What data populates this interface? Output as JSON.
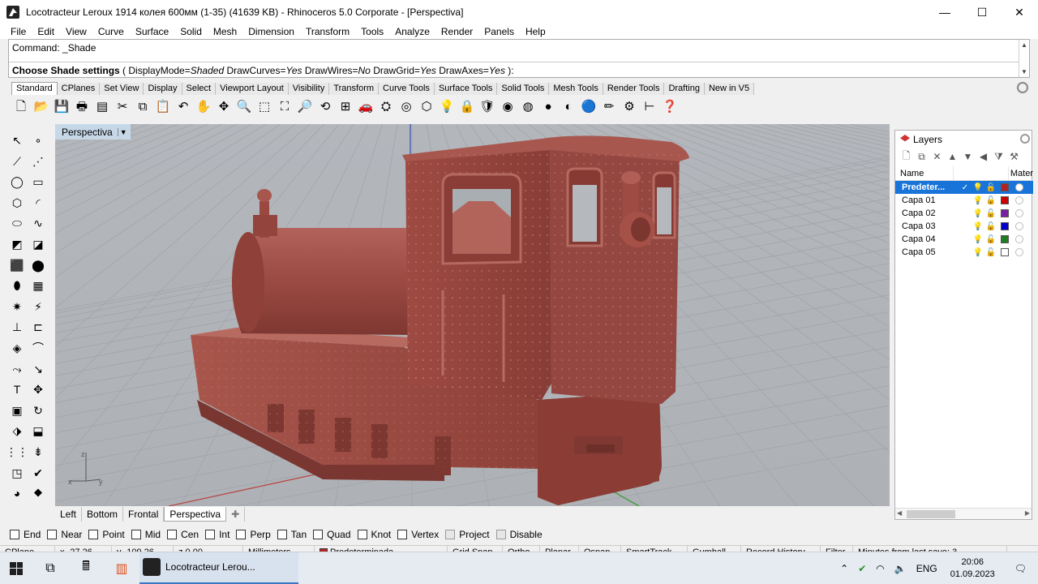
{
  "window": {
    "title": "Locotracteur Leroux 1914 колея 600мм (1-35) (41639 KB) - Rhinoceros  5.0 Corporate - [Perspectiva]",
    "minimize": "—",
    "maximize": "☐",
    "close": "✕"
  },
  "menu": [
    "File",
    "Edit",
    "View",
    "Curve",
    "Surface",
    "Solid",
    "Mesh",
    "Dimension",
    "Transform",
    "Tools",
    "Analyze",
    "Render",
    "Panels",
    "Help"
  ],
  "command": {
    "history": "Command: _Shade",
    "prompt_bold": "Choose Shade settings",
    "prompt_rest_1": " ( DisplayMode=",
    "display_mode": "Shaded",
    "prompt_rest_2": "  DrawCurves=",
    "draw_curves": "Yes",
    "prompt_rest_3": "  DrawWires=",
    "draw_wires": "No",
    "prompt_rest_4": "  DrawGrid=",
    "draw_grid": "Yes",
    "prompt_rest_5": "  DrawAxes=",
    "draw_axes": "Yes",
    "prompt_end": " ):"
  },
  "toolbar_tabs": [
    "Standard",
    "CPlanes",
    "Set View",
    "Display",
    "Select",
    "Viewport Layout",
    "Visibility",
    "Transform",
    "Curve Tools",
    "Surface Tools",
    "Solid Tools",
    "Mesh Tools",
    "Render Tools",
    "Drafting",
    "New in V5"
  ],
  "toolbar_icons": [
    {
      "name": "new-file-icon",
      "glyph": "🗋"
    },
    {
      "name": "open-file-icon",
      "glyph": "📂"
    },
    {
      "name": "save-icon",
      "glyph": "💾"
    },
    {
      "name": "print-icon",
      "glyph": "🖶"
    },
    {
      "name": "import-icon",
      "glyph": "▤"
    },
    {
      "name": "cut-icon",
      "glyph": "✂"
    },
    {
      "name": "copy-icon",
      "glyph": "⧉"
    },
    {
      "name": "paste-icon",
      "glyph": "📋"
    },
    {
      "name": "undo-icon",
      "glyph": "↶"
    },
    {
      "name": "pan-icon",
      "glyph": "✋"
    },
    {
      "name": "move-view-icon",
      "glyph": "✥"
    },
    {
      "name": "zoom-icon",
      "glyph": "🔍"
    },
    {
      "name": "zoom-window-icon",
      "glyph": "⬚"
    },
    {
      "name": "zoom-extents-icon",
      "glyph": "⛶"
    },
    {
      "name": "zoom-selected-icon",
      "glyph": "🔎"
    },
    {
      "name": "rotate-view-icon",
      "glyph": "⟲"
    },
    {
      "name": "four-viewports-icon",
      "glyph": "⊞"
    },
    {
      "name": "car-icon",
      "glyph": "🚗"
    },
    {
      "name": "camera-icon",
      "glyph": "⛭"
    },
    {
      "name": "target-icon",
      "glyph": "◎"
    },
    {
      "name": "cplane-icon",
      "glyph": "⬡"
    },
    {
      "name": "light-bulb-icon",
      "glyph": "💡"
    },
    {
      "name": "lock-icon",
      "glyph": "🔒"
    },
    {
      "name": "layer-shield-icon",
      "glyph": "🛡"
    },
    {
      "name": "color-wheel-icon",
      "glyph": "◉"
    },
    {
      "name": "sphere-wire-icon",
      "glyph": "◍"
    },
    {
      "name": "sphere-shaded-icon",
      "glyph": "●"
    },
    {
      "name": "sphere-render-icon",
      "glyph": "◐"
    },
    {
      "name": "sphere-blue-icon",
      "glyph": "🔵"
    },
    {
      "name": "pencil-icon",
      "glyph": "✏"
    },
    {
      "name": "gear-gold-icon",
      "glyph": "⚙"
    },
    {
      "name": "dimension-icon",
      "glyph": "⊢"
    },
    {
      "name": "help-icon",
      "glyph": "❓"
    }
  ],
  "left_palette": [
    {
      "name": "select-arrow-icon",
      "glyph": "↖"
    },
    {
      "name": "point-icon",
      "glyph": "∘"
    },
    {
      "name": "polyline-icon",
      "glyph": "⟋"
    },
    {
      "name": "curve-points-icon",
      "glyph": "⋰"
    },
    {
      "name": "circle-icon",
      "glyph": "◯"
    },
    {
      "name": "rectangle-icon",
      "glyph": "▭"
    },
    {
      "name": "polygon-icon",
      "glyph": "⬡"
    },
    {
      "name": "arc-icon",
      "glyph": "◜"
    },
    {
      "name": "ellipse-icon",
      "glyph": "⬭"
    },
    {
      "name": "freeform-icon",
      "glyph": "∿"
    },
    {
      "name": "surface-corner-icon",
      "glyph": "◩"
    },
    {
      "name": "surface-patch-icon",
      "glyph": "◪"
    },
    {
      "name": "box-icon",
      "glyph": "⬛"
    },
    {
      "name": "solid-union-icon",
      "glyph": "⬤"
    },
    {
      "name": "cylinder-icon",
      "glyph": "⬮"
    },
    {
      "name": "mesh-icon",
      "glyph": "▦"
    },
    {
      "name": "explode-icon",
      "glyph": "✷"
    },
    {
      "name": "trim-icon",
      "glyph": "⚡"
    },
    {
      "name": "split-icon",
      "glyph": "⊥"
    },
    {
      "name": "join-icon",
      "glyph": "⊏"
    },
    {
      "name": "boolean-icon",
      "glyph": "◈"
    },
    {
      "name": "fillet-icon",
      "glyph": "⌒"
    },
    {
      "name": "offset-icon",
      "glyph": "⤳"
    },
    {
      "name": "extend-icon",
      "glyph": "↘"
    },
    {
      "name": "text-icon",
      "glyph": "T"
    },
    {
      "name": "move-icon",
      "glyph": "✥"
    },
    {
      "name": "scale-icon",
      "glyph": "▣"
    },
    {
      "name": "rotate-icon",
      "glyph": "↻"
    },
    {
      "name": "extrude-icon",
      "glyph": "⬗"
    },
    {
      "name": "array-icon",
      "glyph": "⬓"
    },
    {
      "name": "grid-array-icon",
      "glyph": "⋮⋮"
    },
    {
      "name": "align-icon",
      "glyph": "⇟"
    },
    {
      "name": "analyze-icon",
      "glyph": "◳"
    },
    {
      "name": "check-icon",
      "glyph": "✔"
    },
    {
      "name": "sphere-tool-icon",
      "glyph": "◕"
    },
    {
      "name": "render-tool-icon",
      "glyph": "⯁"
    }
  ],
  "viewport": {
    "title": "Perspectiva",
    "dropdown": "▼"
  },
  "viewport_tabs": [
    "Left",
    "Bottom",
    "Frontal",
    "Perspectiva"
  ],
  "viewport_tab_add": "✚",
  "layers": {
    "title": "Layers",
    "columns": {
      "name": "Name",
      "material": "Mater"
    },
    "rows": [
      {
        "name": "Predeter...",
        "current": "✓",
        "color": "#b22222",
        "selected": true
      },
      {
        "name": "Capa 01",
        "current": "",
        "color": "#cc0000",
        "selected": false
      },
      {
        "name": "Capa 02",
        "current": "",
        "color": "#7b1fa2",
        "selected": false
      },
      {
        "name": "Capa 03",
        "current": "",
        "color": "#0000cc",
        "selected": false
      },
      {
        "name": "Capa 04",
        "current": "",
        "color": "#1e7d1e",
        "selected": false
      },
      {
        "name": "Capa 05",
        "current": "",
        "color": "#ffffff",
        "selected": false
      }
    ]
  },
  "osnaps": [
    {
      "label": "End",
      "enabled": true
    },
    {
      "label": "Near",
      "enabled": true
    },
    {
      "label": "Point",
      "enabled": true
    },
    {
      "label": "Mid",
      "enabled": true
    },
    {
      "label": "Cen",
      "enabled": true
    },
    {
      "label": "Int",
      "enabled": true
    },
    {
      "label": "Perp",
      "enabled": true
    },
    {
      "label": "Tan",
      "enabled": true
    },
    {
      "label": "Quad",
      "enabled": true
    },
    {
      "label": "Knot",
      "enabled": true
    },
    {
      "label": "Vertex",
      "enabled": true
    },
    {
      "label": "Project",
      "enabled": false
    },
    {
      "label": "Disable",
      "enabled": false
    }
  ],
  "status": {
    "cplane": "CPlane",
    "x": "x -27.26",
    "y": "y -109.26",
    "z": "z 0.00",
    "units": "Millimeters",
    "layer": "Predeterminada",
    "grid_snap": "Grid Snap",
    "ortho": "Ortho",
    "planar": "Planar",
    "osnap": "Osnap",
    "smarttrack": "SmartTrack",
    "gumball": "Gumball",
    "record_history": "Record History",
    "filter": "Filter",
    "save_info": "Minutes from last save: 3"
  },
  "taskbar": {
    "active_app": "Locotracteur Lerou...",
    "lang": "ENG",
    "time": "20:06",
    "date": "01.09.2023"
  },
  "colors": {
    "model_body": "#9c4b44",
    "viewport_bg": "#b0b4b8",
    "selection": "#1874d9"
  }
}
